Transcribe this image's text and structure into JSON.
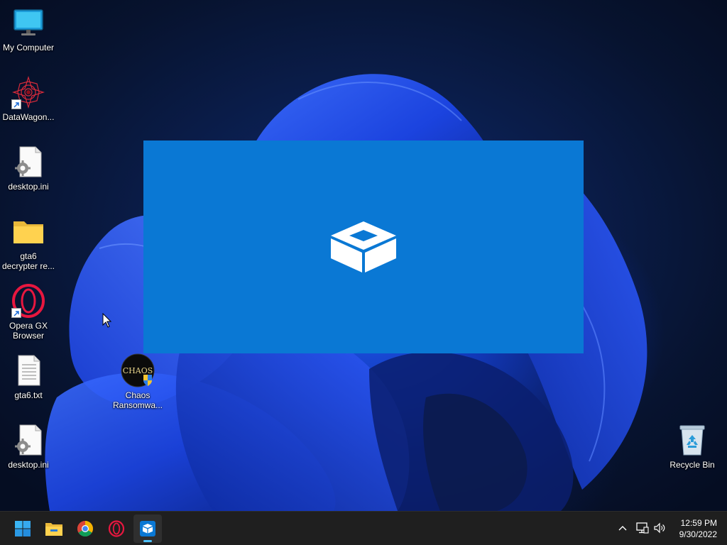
{
  "desktop": {
    "icons": [
      {
        "label": "My Computer"
      },
      {
        "label": "DataWagon..."
      },
      {
        "label": "desktop.ini"
      },
      {
        "label": "gta6\ndecrypter re..."
      },
      {
        "label": "Opera GX\nBrowser"
      },
      {
        "label": "gta6.txt"
      },
      {
        "label": "desktop.ini"
      },
      {
        "label": "Chaos\nRansomwa...",
        "badge_text": "CHAOS"
      },
      {
        "label": "Recycle Bin"
      }
    ]
  },
  "splash": {
    "icon": "sandbox-box-icon",
    "color": "#0a78d4"
  },
  "taskbar": {
    "buttons": [
      {
        "icon": "windows-start-icon"
      },
      {
        "icon": "file-explorer-icon"
      },
      {
        "icon": "chrome-icon"
      },
      {
        "icon": "opera-gx-icon"
      },
      {
        "icon": "windows-sandbox-icon",
        "active": true
      }
    ],
    "tray": {
      "icons": [
        "chevron-up-icon",
        "network-icon",
        "volume-icon"
      ],
      "time": "12:59 PM",
      "date": "9/30/2022"
    }
  },
  "colors": {
    "taskbar": "#1f1f1f",
    "accent": "#0a78d4",
    "indicator": "#4cc2ff"
  }
}
